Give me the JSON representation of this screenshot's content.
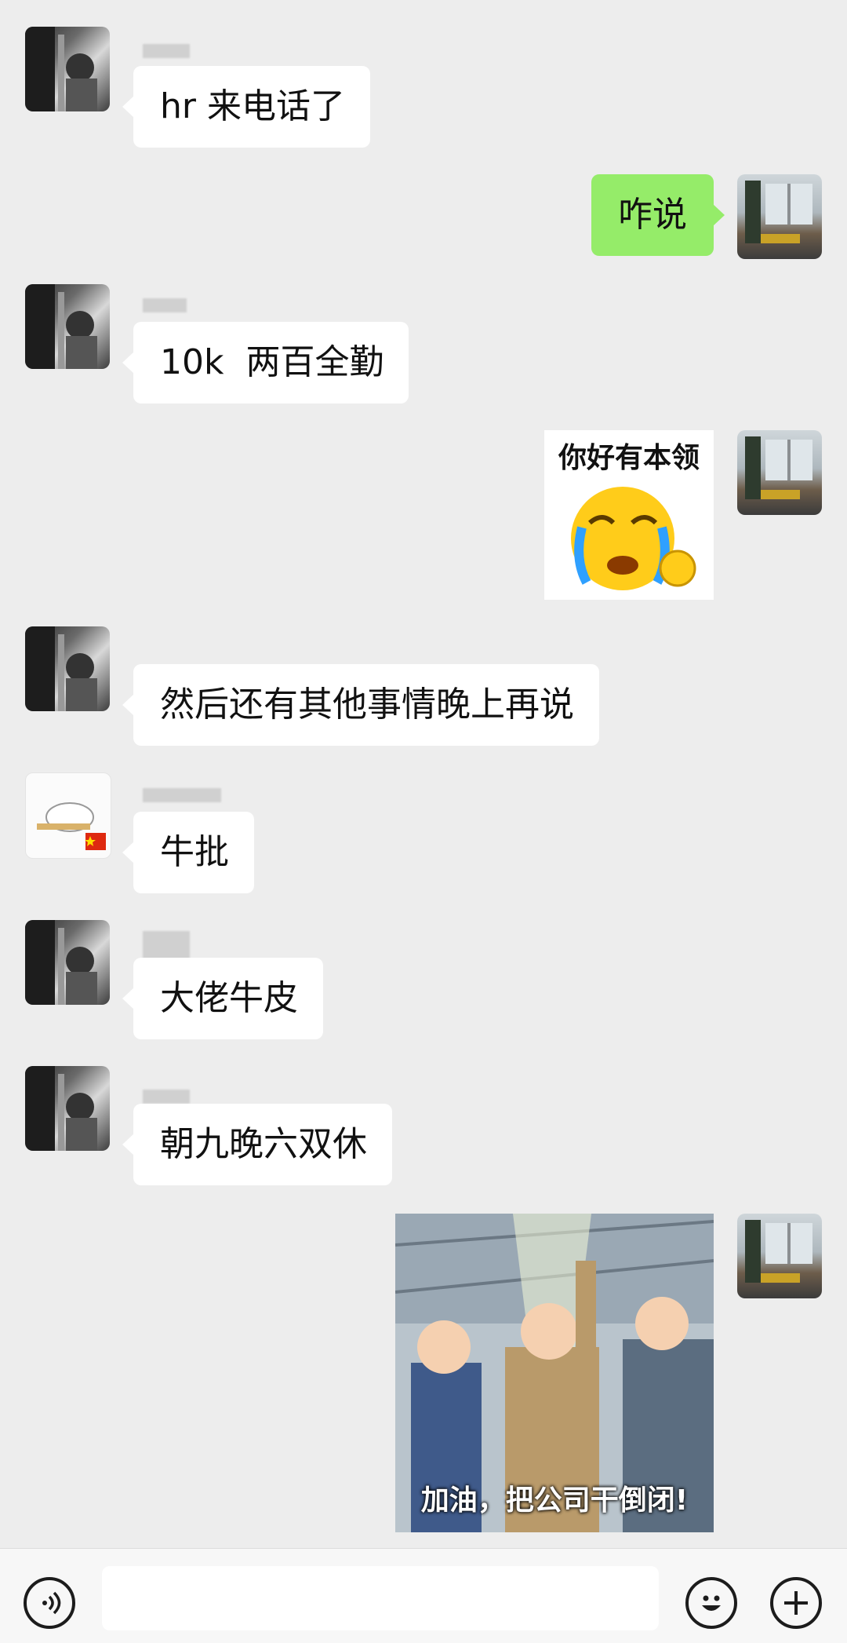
{
  "messages": [
    {
      "text": "hr 来电话了"
    },
    {
      "text": "咋说"
    },
    {
      "text": "10k  两百全勤"
    },
    {
      "text": "你好有本领"
    },
    {
      "text": "然后还有其他事情晚上再说"
    },
    {
      "text": "牛批"
    },
    {
      "text": "大佬牛皮"
    },
    {
      "text": "朝九晚六双休"
    },
    {
      "text": "加油，把公司干倒闭!"
    }
  ],
  "colors": {
    "background": "#ededed",
    "own_bubble": "#95ec69",
    "other_bubble": "#ffffff"
  },
  "icons": [
    "voice-icon",
    "emoji-icon",
    "plus-icon",
    "china-flag-icon"
  ]
}
